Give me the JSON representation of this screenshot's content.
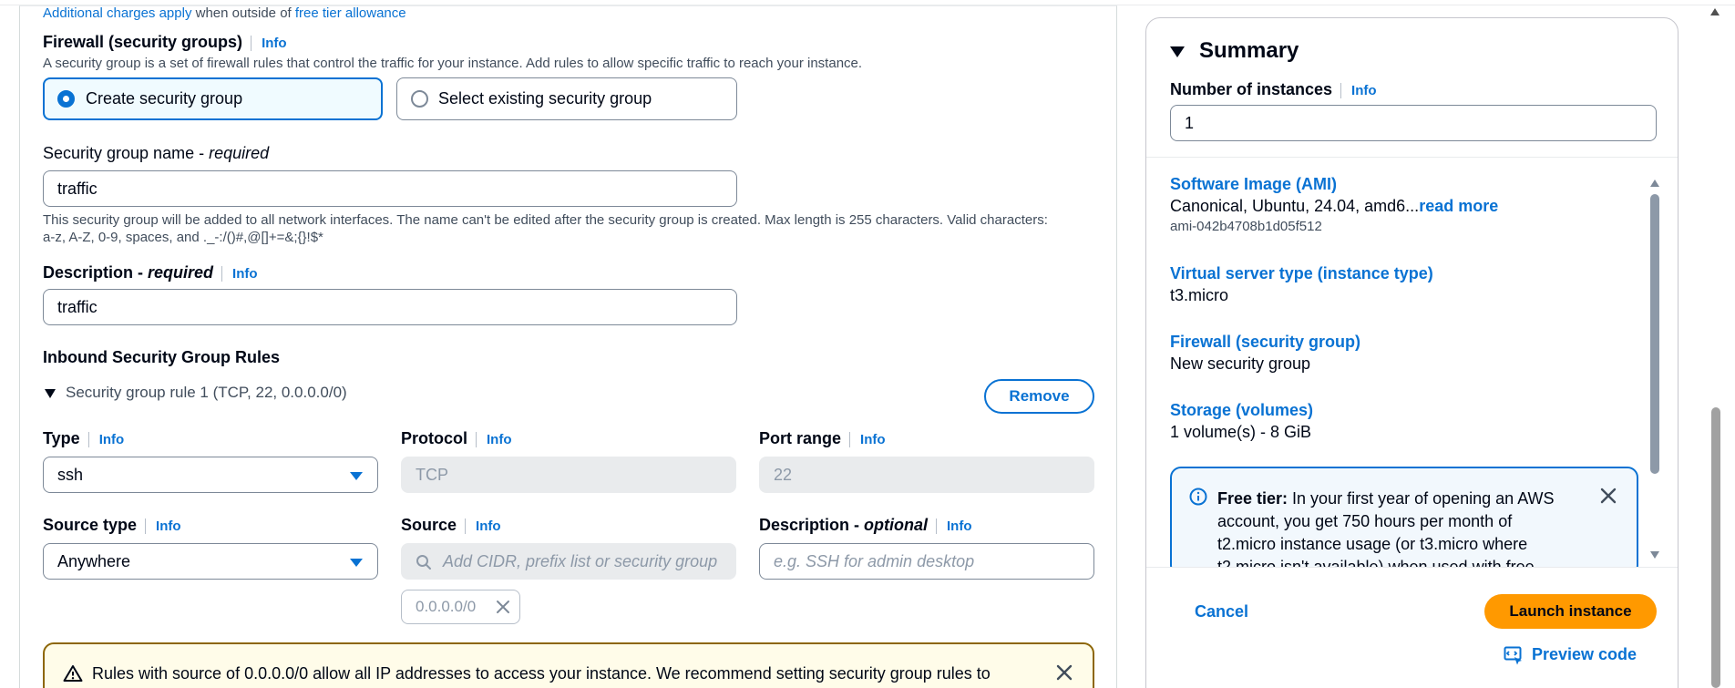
{
  "top": {
    "additional_charges_link": "Additional charges apply",
    "when_outside_text": "when outside of",
    "free_tier_link": "free tier allowance"
  },
  "firewall": {
    "label": "Firewall (security groups)",
    "info": "Info",
    "description": "A security group is a set of firewall rules that control the traffic for your instance. Add rules to allow specific traffic to reach your instance.",
    "option_create": "Create security group",
    "option_select": "Select existing security group"
  },
  "sg_name": {
    "label": "Security group name - ",
    "required": "required",
    "value": "traffic",
    "hint_line1": "This security group will be added to all network interfaces. The name can't be edited after the security group is created. Max length is 255 characters. Valid characters:",
    "hint_line2": "a-z, A-Z, 0-9, spaces, and ._-:/()#,@[]+=&;{}!$*"
  },
  "sg_description": {
    "label": "Description - ",
    "required": "required",
    "info": "Info",
    "value": "traffic"
  },
  "inbound": {
    "heading": "Inbound Security Group Rules",
    "rule_title": "Security group rule 1 (TCP, 22, 0.0.0.0/0)",
    "remove_button": "Remove",
    "type_label": "Type",
    "type_info": "Info",
    "type_value": "ssh",
    "protocol_label": "Protocol",
    "protocol_info": "Info",
    "protocol_value": "TCP",
    "port_label": "Port range",
    "port_info": "Info",
    "port_value": "22",
    "source_type_label": "Source type",
    "source_type_info": "Info",
    "source_type_value": "Anywhere",
    "source_label": "Source",
    "source_info": "Info",
    "source_placeholder": "Add CIDR, prefix list or security group",
    "source_token": "0.0.0.0/0",
    "desc_label": "Description - ",
    "desc_optional": "optional",
    "desc_info": "Info",
    "desc_placeholder": "e.g. SSH for admin desktop"
  },
  "warning": {
    "text": "Rules with source of 0.0.0.0/0 allow all IP addresses to access your instance. We recommend setting security group rules to"
  },
  "summary": {
    "title": "Summary",
    "instances_label": "Number of instances",
    "instances_info": "Info",
    "instances_value": "1",
    "ami_title": "Software Image (AMI)",
    "ami_value": "Canonical, Ubuntu, 24.04, amd6...",
    "ami_read_more": "read more",
    "ami_id": "ami-042b4708b1d05f512",
    "server_type_title": "Virtual server type (instance type)",
    "server_type_value": "t3.micro",
    "firewall_title": "Firewall (security group)",
    "firewall_value": "New security group",
    "storage_title": "Storage (volumes)",
    "storage_value": "1 volume(s) - 8 GiB",
    "free_tier_label": "Free tier:",
    "free_tier_line1": "In your first year of opening an AWS",
    "free_tier_line2": "account, you get 750 hours per month of",
    "free_tier_line3": "t2.micro instance usage (or t3.micro where",
    "free_tier_line4": "t2.micro isn't available) when used with free",
    "cancel": "Cancel",
    "launch": "Launch instance",
    "preview_code": "Preview code"
  },
  "colors": {
    "link": "#0972d3",
    "primary_button": "#ff9900",
    "warning_border": "#8d6605",
    "info_border": "#0972d3"
  },
  "icons": [
    "radio-selected-icon",
    "radio-unselected-icon",
    "caret-down-icon",
    "expand-triangle-icon",
    "search-icon",
    "close-icon",
    "warning-icon",
    "info-circle-icon",
    "code-preview-icon",
    "scroll-up-icon",
    "scroll-down-icon"
  ]
}
